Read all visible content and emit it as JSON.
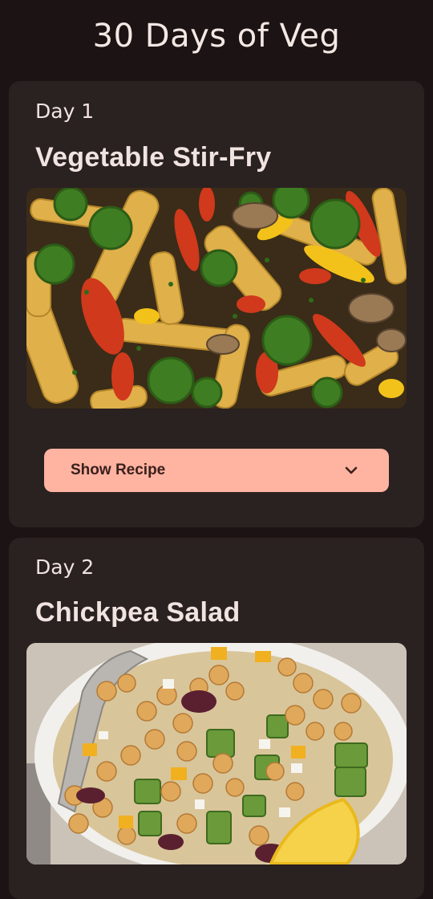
{
  "app": {
    "title": "30 Days of Veg"
  },
  "cards": [
    {
      "day": "Day 1",
      "title": "Vegetable Stir-Fry",
      "button_label": "Show Recipe",
      "button_icon": "chevron-down-icon"
    },
    {
      "day": "Day 2",
      "title": "Chickpea Salad"
    }
  ],
  "colors": {
    "background": "#1c1414",
    "card": "#2a2121",
    "button": "#ffb3a1",
    "text": "#f4e8e4"
  }
}
